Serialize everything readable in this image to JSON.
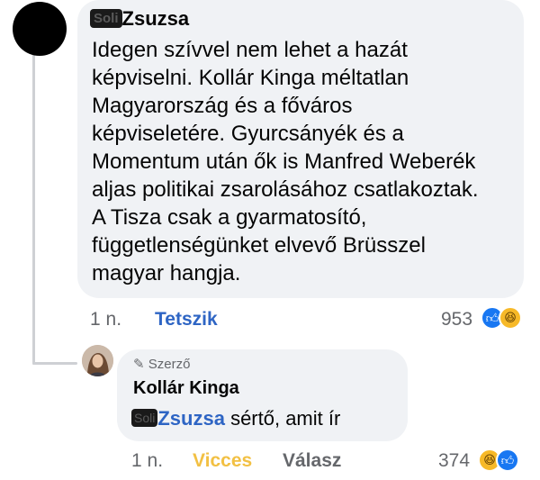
{
  "comment": {
    "author_redacted": "Soli",
    "author_name": "Zsuzsa",
    "body_lines": [
      "Idegen szívvel nem lehet a hazát",
      "képviselni. Kollár Kinga méltatlan",
      "Magyarország és a főváros",
      "képviseletére. Gyurcsányék és a",
      "Momentum után ők is Manfred Weberék",
      "aljas politikai zsarolásához csatlakoztak.",
      "A Tisza csak a gyarmatosító,",
      "függetlenségünket elvevő Brüsszel",
      "magyar hangja."
    ],
    "time": "1 n.",
    "like_label": "Tetszik",
    "reaction_count": "953",
    "reactions": [
      "like-icon",
      "haha-icon"
    ]
  },
  "reply": {
    "author_tag": "Szerző",
    "author_name": "Kollár Kinga",
    "mention_redacted": "Soli",
    "mention_name": "Zsuzsa",
    "text": " sértő,  amit ír",
    "time": "1 n.",
    "funny_label": "Vicces",
    "reply_label": "Válasz",
    "reaction_count": "374",
    "reactions": [
      "haha-icon",
      "like-icon"
    ]
  },
  "colors": {
    "bubble": "#f0f2f5",
    "link_blue": "#2e65c4",
    "funny_yellow": "#f2c043",
    "muted": "#65676b"
  }
}
